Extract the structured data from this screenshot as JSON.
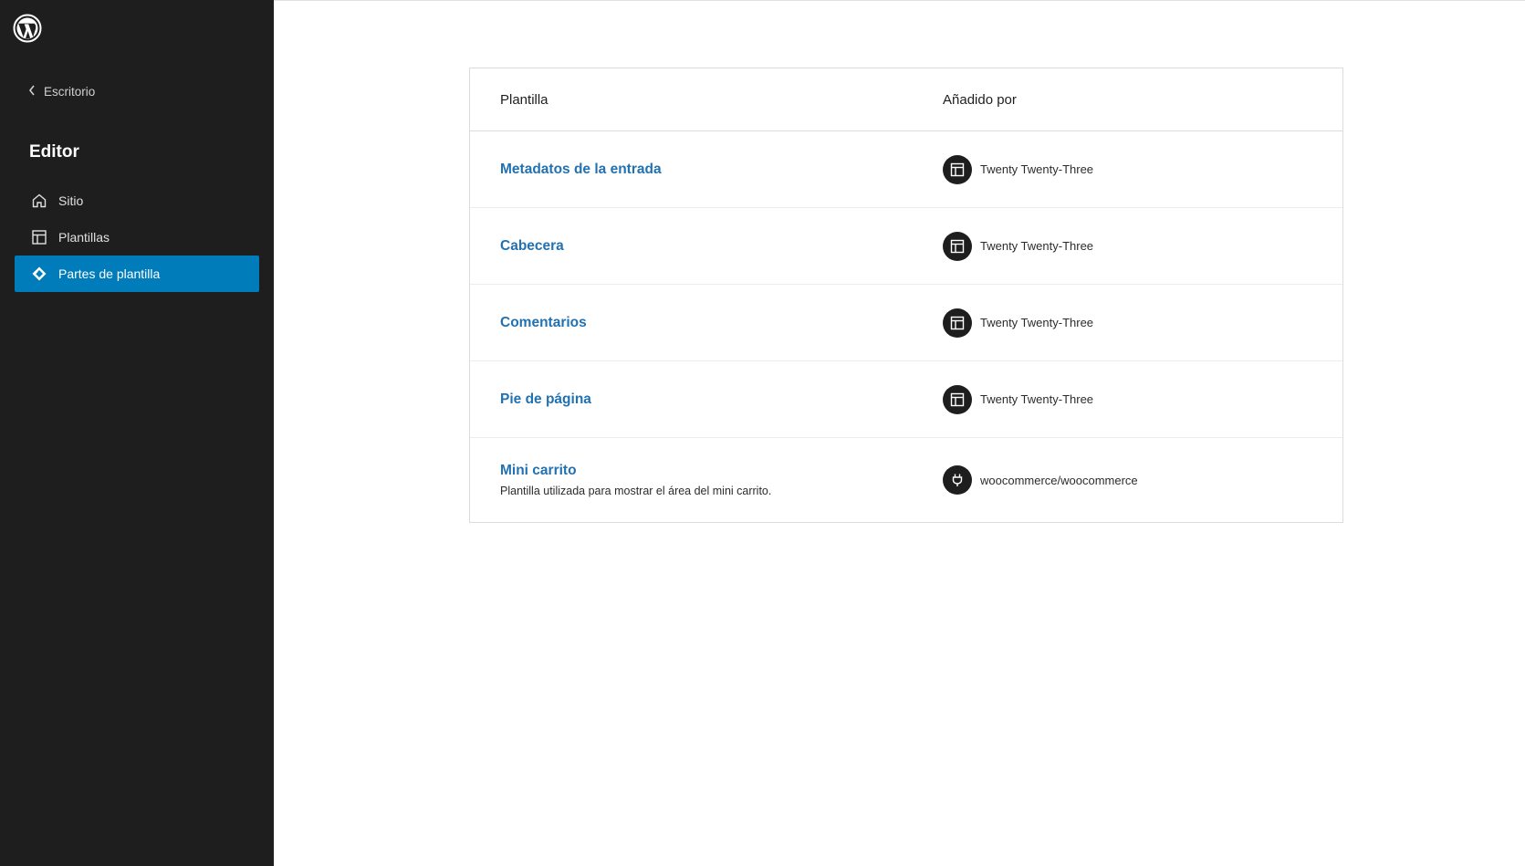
{
  "sidebar": {
    "logo_icon": "wordpress-logo-icon",
    "back_label": "Escritorio",
    "title": "Editor",
    "items": [
      {
        "label": "Sitio",
        "icon": "home-icon",
        "active": false
      },
      {
        "label": "Plantillas",
        "icon": "layout-icon",
        "active": false
      },
      {
        "label": "Partes de plantilla",
        "icon": "symbol-icon",
        "active": true
      }
    ],
    "accent_color": "#007cba",
    "background_color": "#1e1e1e"
  },
  "table": {
    "headers": {
      "template": "Plantilla",
      "added_by": "Añadido por"
    },
    "rows": [
      {
        "title": "Metadatos de la entrada",
        "description": "",
        "author": "Twenty Twenty-Three",
        "author_icon": "layout-icon"
      },
      {
        "title": "Cabecera",
        "description": "",
        "author": "Twenty Twenty-Three",
        "author_icon": "layout-icon"
      },
      {
        "title": "Comentarios",
        "description": "",
        "author": "Twenty Twenty-Three",
        "author_icon": "layout-icon"
      },
      {
        "title": "Pie de página",
        "description": "",
        "author": "Twenty Twenty-Three",
        "author_icon": "layout-icon"
      },
      {
        "title": "Mini carrito",
        "description": "Plantilla utilizada para mostrar el área del mini carrito.",
        "author": "woocommerce/woocommerce",
        "author_icon": "plugin-icon"
      }
    ],
    "link_color": "#2271b1"
  }
}
